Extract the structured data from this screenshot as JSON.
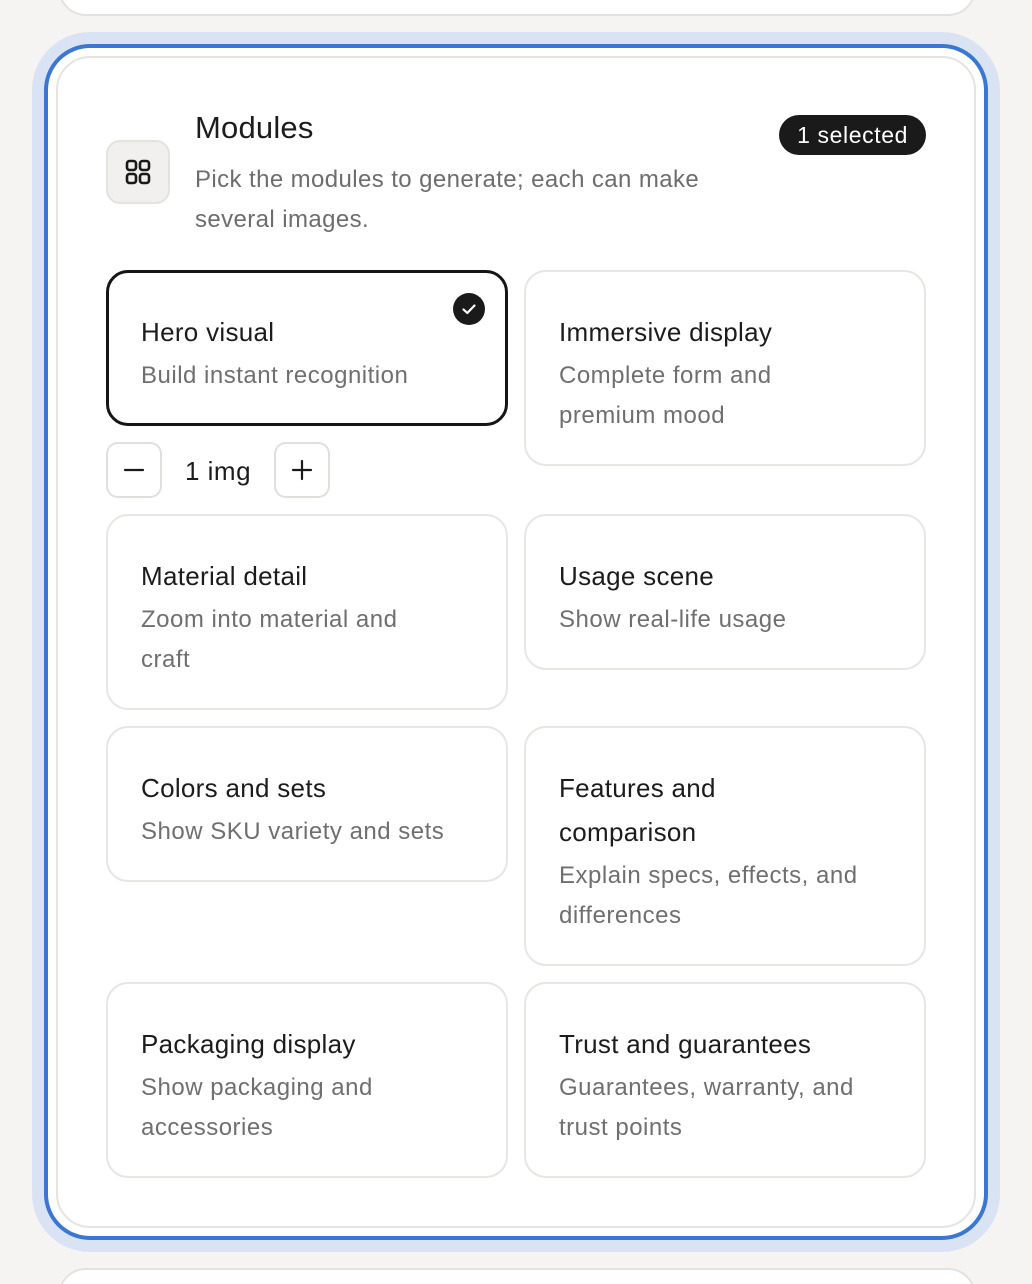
{
  "header": {
    "title": "Modules",
    "subtitle": "Pick the modules to generate; each can make several images.",
    "selected_badge": "1 selected",
    "icon": "grid-icon"
  },
  "stepper": {
    "value": "1 img",
    "decrement_icon": "minus-icon",
    "increment_icon": "plus-icon"
  },
  "modules": [
    {
      "title": "Hero visual",
      "description": "Build instant recognition",
      "selected": true
    },
    {
      "title": "Immersive display",
      "description": "Complete form and premium mood",
      "selected": false
    },
    {
      "title": "Material detail",
      "description": "Zoom into material and craft",
      "selected": false
    },
    {
      "title": "Usage scene",
      "description": "Show real-life usage",
      "selected": false
    },
    {
      "title": "Colors and sets",
      "description": "Show SKU variety and sets",
      "selected": false
    },
    {
      "title": "Features and comparison",
      "description": "Explain specs, effects, and differences",
      "selected": false
    },
    {
      "title": "Packaging display",
      "description": "Show packaging and accessories",
      "selected": false
    },
    {
      "title": "Trust and guarantees",
      "description": "Guarantees, warranty, and trust points",
      "selected": false
    }
  ],
  "colors": {
    "focus_ring": "#3a77d2",
    "focus_halo": "#d9e3f3",
    "badge_bg": "#1a1a1a",
    "selected_border": "#151515"
  }
}
